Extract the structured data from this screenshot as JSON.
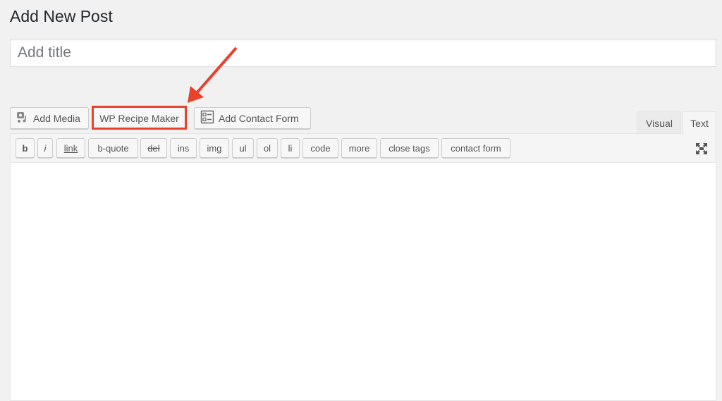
{
  "page_title": "Add New Post",
  "title_placeholder": "Add title",
  "media_buttons": {
    "add_media": "Add Media",
    "recipe_maker": "WP Recipe Maker",
    "contact_form": "Add Contact Form"
  },
  "tabs": {
    "visual": "Visual",
    "text": "Text"
  },
  "quicktags": [
    "b",
    "i",
    "link",
    "b-quote",
    "del",
    "ins",
    "img",
    "ul",
    "ol",
    "li",
    "code",
    "more",
    "close tags",
    "contact form"
  ],
  "colors": {
    "highlight": "#e8412c",
    "background": "#f1f1f1"
  }
}
